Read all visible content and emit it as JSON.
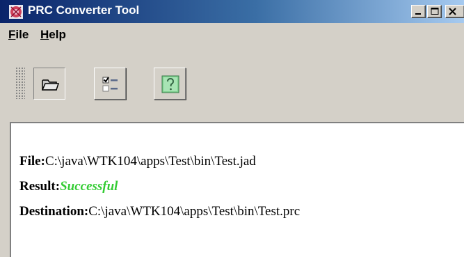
{
  "window": {
    "title": "PRC Converter Tool"
  },
  "menu": {
    "file_mnemonic": "F",
    "file_rest": "ile",
    "help_mnemonic": "H",
    "help_rest": "elp"
  },
  "toolbar": {
    "buttons": [
      {
        "icon": "folder-open-icon",
        "state": "pressed"
      },
      {
        "icon": "checklist-icon",
        "state": "normal"
      },
      {
        "icon": "question-mark-icon",
        "state": "normal"
      }
    ]
  },
  "output": {
    "file_label": "File:",
    "file_value": "C:\\java\\WTK104\\apps\\Test\\bin\\Test.jad",
    "result_label": "Result:",
    "result_value": "Successful",
    "destination_label": "Destination:",
    "destination_value": "C:\\java\\WTK104\\apps\\Test\\bin\\Test.prc"
  },
  "colors": {
    "titlebar_start": "#0a246a",
    "titlebar_end": "#a6caf0",
    "window_bg": "#d4d0c8",
    "success": "#33cc33"
  }
}
